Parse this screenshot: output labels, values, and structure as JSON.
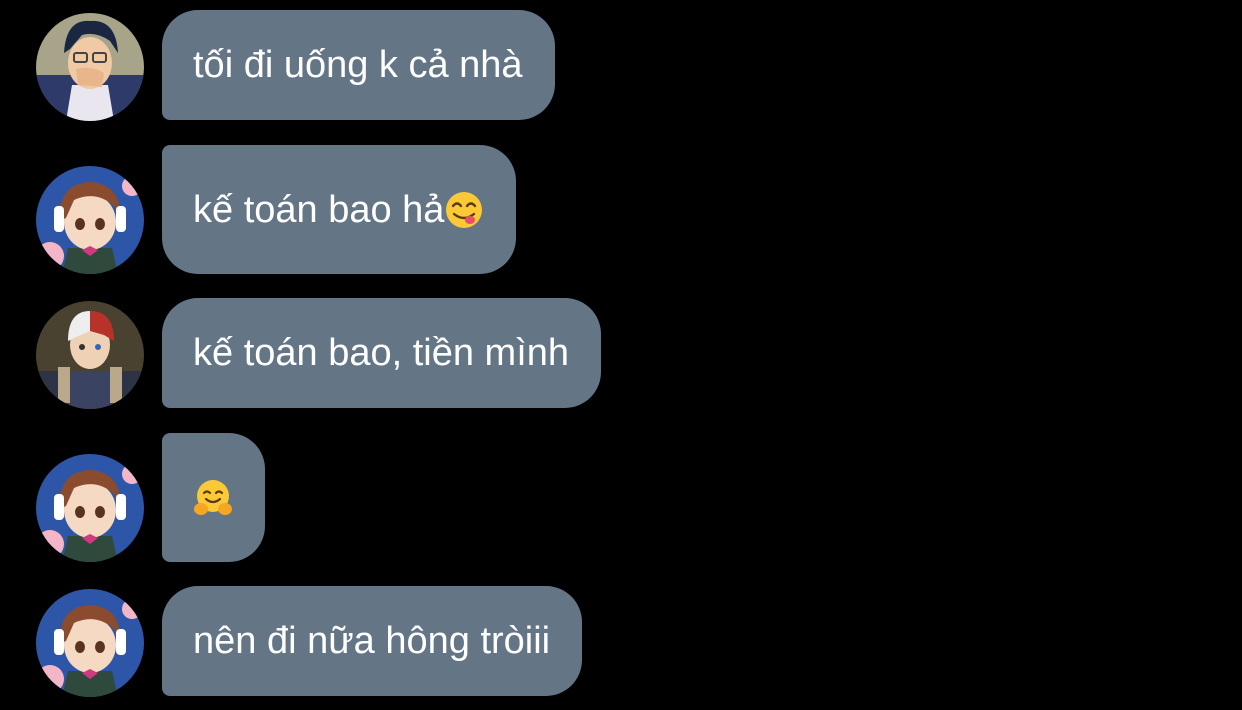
{
  "messages": [
    {
      "sender": "iida",
      "text": "tối đi uống k cả nhà",
      "emoji": ""
    },
    {
      "sender": "uraraka",
      "text": "kế toán bao hả",
      "emoji": "yummy-face"
    },
    {
      "sender": "todoroki",
      "text": "kế toán bao, tiền mình",
      "emoji": ""
    },
    {
      "sender": "uraraka",
      "text": "",
      "emoji": "hugging-face"
    },
    {
      "sender": "uraraka",
      "text": "nên đi nữa hông tròiii",
      "emoji": ""
    }
  ],
  "colors": {
    "background": "#000000",
    "bubble": "#647586",
    "text": "#ffffff"
  }
}
